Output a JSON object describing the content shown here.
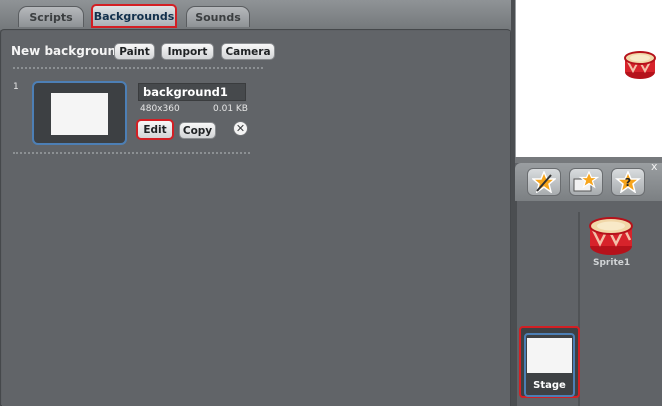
{
  "tabs": [
    {
      "label": "Scripts"
    },
    {
      "label": "Backgrounds"
    },
    {
      "label": "Sounds"
    }
  ],
  "new_background": {
    "label": "New background:",
    "buttons": {
      "paint": "Paint",
      "import": "Import",
      "camera": "Camera"
    }
  },
  "costume": {
    "index": "1",
    "name": "background1",
    "dimensions": "480x360",
    "size": "0.01 KB",
    "edit_label": "Edit",
    "copy_label": "Copy",
    "delete_symbol": "✕"
  },
  "sprite_toolbar": {
    "close_symbol": "x"
  },
  "sprites": [
    {
      "label": "Sprite1"
    }
  ],
  "stage_tile": {
    "label": "Stage"
  },
  "colors": {
    "highlight": "#d31f24",
    "selection_blue": "#4d7fb5",
    "panel": "#5f6266"
  },
  "icons": [
    "paint-new-sprite-icon",
    "choose-sprite-file-icon",
    "random-sprite-icon",
    "drum-sprite-icon",
    "delete-icon"
  ]
}
